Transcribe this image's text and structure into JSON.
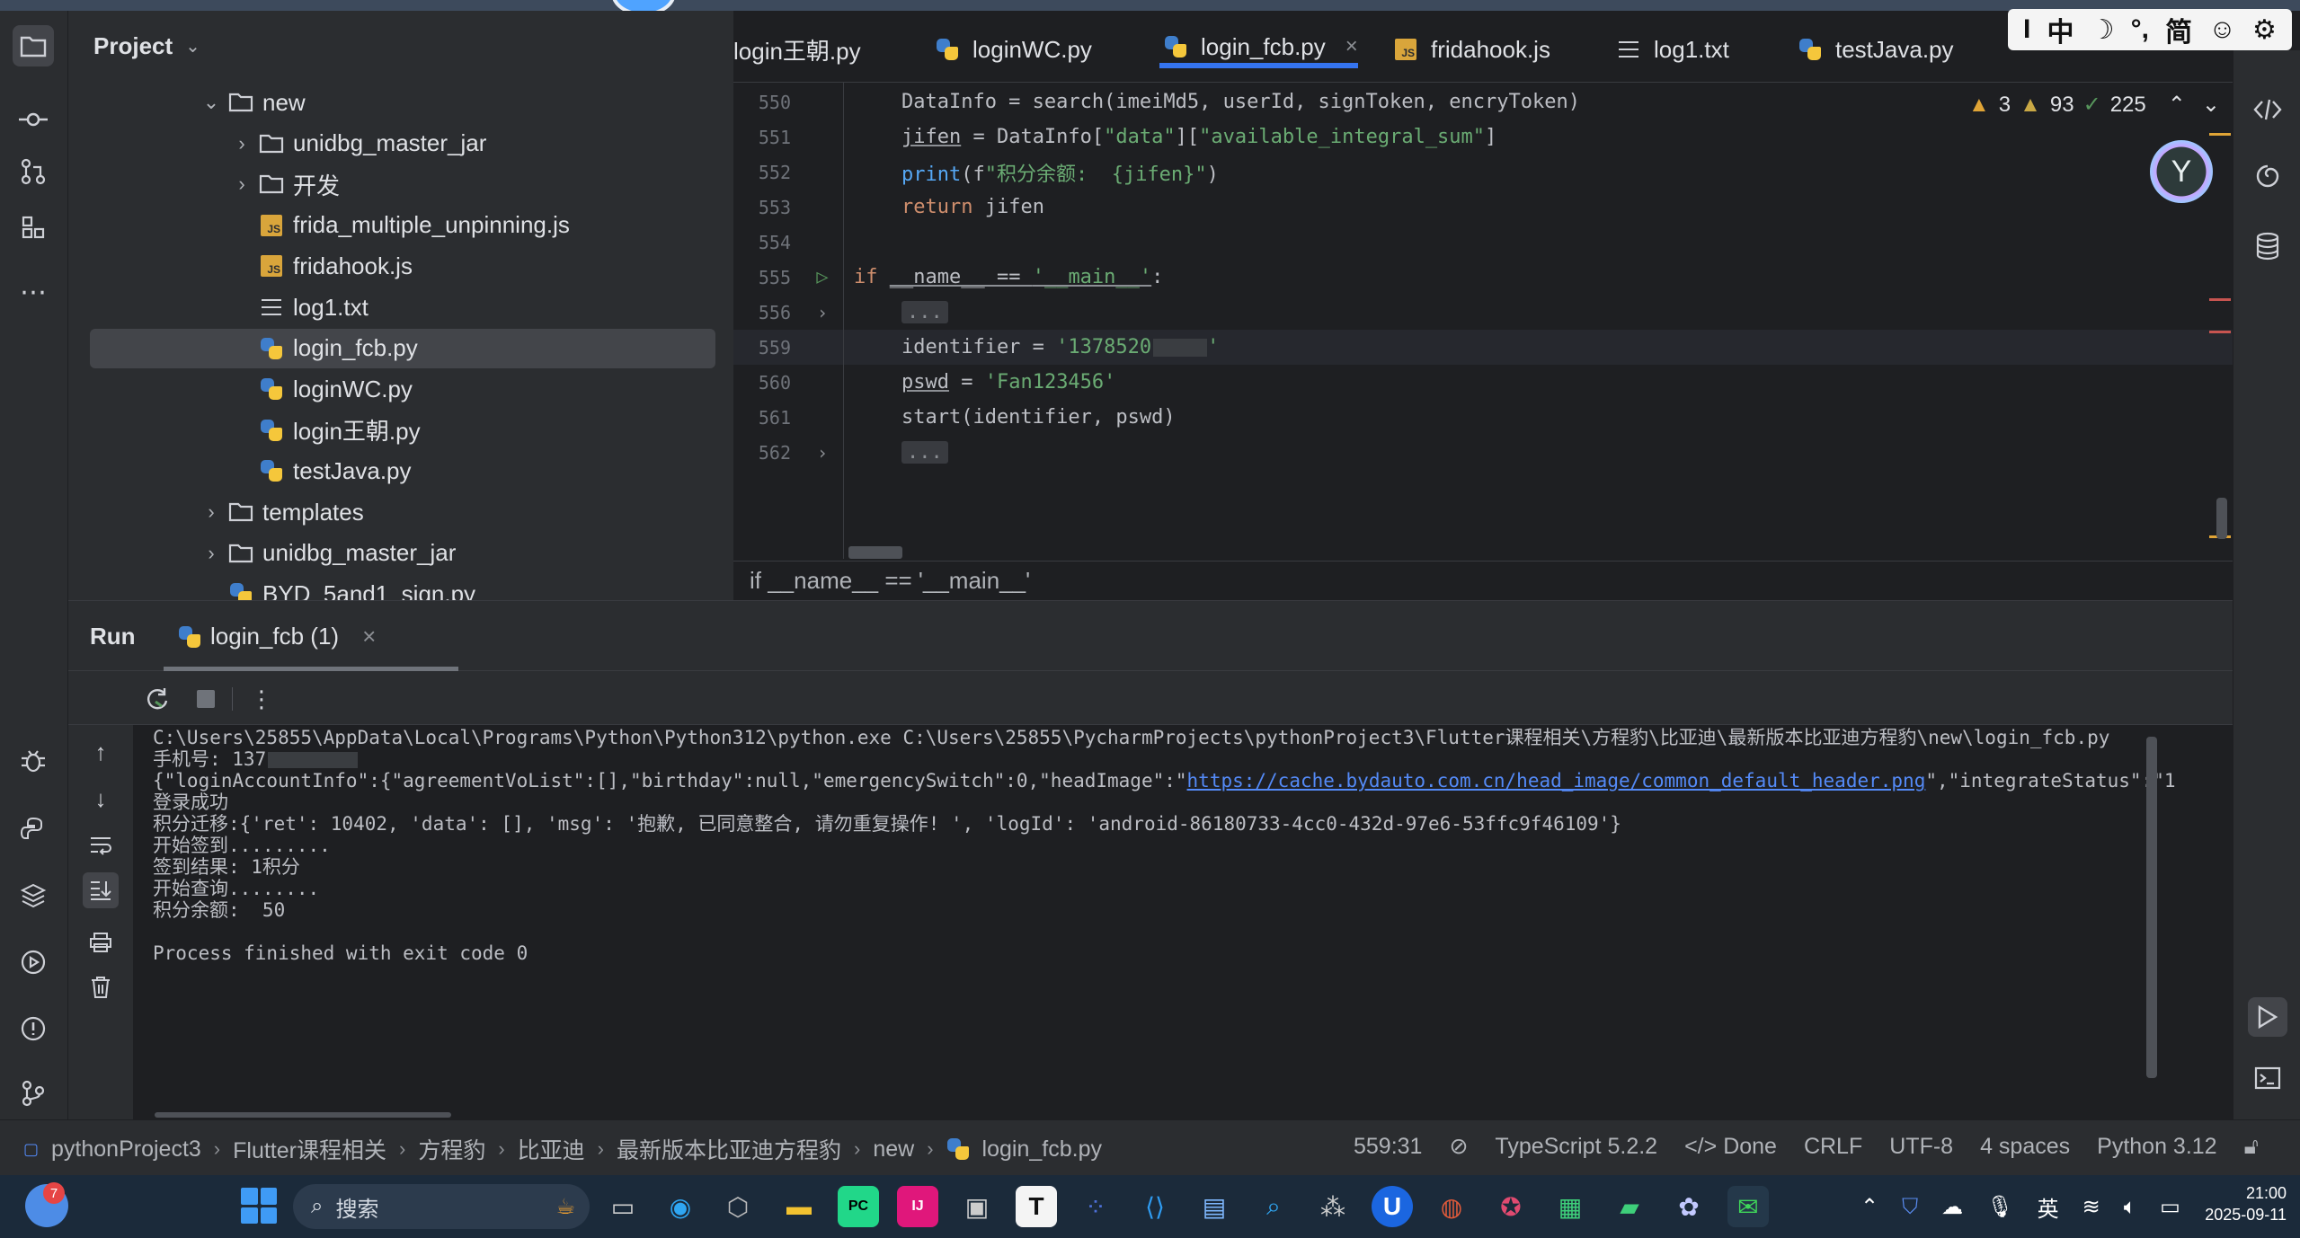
{
  "project": {
    "title": "Project",
    "tree": [
      {
        "label": "new",
        "type": "folder",
        "expanded": true
      },
      {
        "label": "unidbg_master_jar",
        "type": "folder",
        "expanded": false
      },
      {
        "label": "开发",
        "type": "folder",
        "expanded": false
      },
      {
        "label": "frida_multiple_unpinning.js",
        "type": "js"
      },
      {
        "label": "fridahook.js",
        "type": "js"
      },
      {
        "label": "log1.txt",
        "type": "txt"
      },
      {
        "label": "login_fcb.py",
        "type": "py",
        "selected": true
      },
      {
        "label": "loginWC.py",
        "type": "py"
      },
      {
        "label": "login王朝.py",
        "type": "py"
      },
      {
        "label": "testJava.py",
        "type": "py"
      },
      {
        "label": "templates",
        "type": "folder",
        "expanded": false
      },
      {
        "label": "unidbg_master_jar",
        "type": "folder",
        "expanded": false
      },
      {
        "label": "BYD_5and1_sign.py",
        "type": "py"
      }
    ]
  },
  "tabs": [
    {
      "label": "login王朝.py",
      "type": "py"
    },
    {
      "label": "loginWC.py",
      "type": "py"
    },
    {
      "label": "login_fcb.py",
      "type": "py",
      "active": true
    },
    {
      "label": "fridahook.js",
      "type": "js"
    },
    {
      "label": "log1.txt",
      "type": "txt"
    },
    {
      "label": "testJava.py",
      "type": "py"
    }
  ],
  "ime": {
    "items": [
      "I",
      "中",
      "☽",
      "°,",
      "简",
      "☺",
      "⚙"
    ]
  },
  "inspections": {
    "errors": "3",
    "warnings": "93",
    "weak": "225"
  },
  "editor": {
    "lines": [
      {
        "num": "550",
        "text": "    DataInfo = search(imeiMd5, userId, signToken, encryToken)"
      },
      {
        "num": "551",
        "text": "    jifen = DataInfo[\"data\"][\"available_integral_sum\"]"
      },
      {
        "num": "552",
        "text": "    print(f\"积分余额:  {jifen}\")"
      },
      {
        "num": "553",
        "text": "    return jifen"
      },
      {
        "num": "554",
        "text": ""
      },
      {
        "num": "555",
        "text": "if __name__ == '__main__':"
      },
      {
        "num": "556",
        "text": "    ..."
      },
      {
        "num": "559",
        "text": "    identifier = '1378520"
      },
      {
        "num": "560",
        "text": "    pswd = 'Fan123456'"
      },
      {
        "num": "561",
        "text": "    start(identifier, pswd)"
      },
      {
        "num": "562",
        "text": "    ..."
      }
    ],
    "breadcrumb": "if __name__ == '__main__'"
  },
  "run": {
    "title": "Run",
    "tab_label": "login_fcb (1)",
    "console": [
      "C:\\Users\\25855\\AppData\\Local\\Programs\\Python\\Python312\\python.exe C:\\Users\\25855\\PycharmProjects\\pythonProject3\\Flutter课程相关\\方程豹\\比亚迪\\最新版本比亚迪方程豹\\new\\login_fcb.py",
      "手机号: 137",
      "{\"loginAccountInfo\":{\"agreementVoList\":[],\"birthday\":null,\"emergencySwitch\":0,\"headImage\":\"",
      "https://cache.bydauto.com.cn/head_image/common_default_header.png",
      "\",\"integrateStatus\":\"1",
      "登录成功",
      "积分迁移:{'ret': 10402, 'data': [], 'msg': '抱歉, 已同意整合, 请勿重复操作! ', 'logId': 'android-86180733-4cc0-432d-97e6-53ffc9f46109'}",
      "开始签到.........",
      "签到结果: 1积分",
      "开始查询........",
      "积分余额:  50",
      "",
      "Process finished with exit code 0"
    ]
  },
  "status": {
    "crumbs": [
      "pythonProject3",
      "Flutter课程相关",
      "方程豹",
      "比亚迪",
      "最新版本比亚迪方程豹",
      "new",
      "login_fcb.py"
    ],
    "position": "559:31",
    "language_service": "TypeScript 5.2.2",
    "done": "Done",
    "line_sep": "CRLF",
    "encoding": "UTF-8",
    "indent": "4 spaces",
    "interpreter": "Python 3.12"
  },
  "taskbar": {
    "weather_badge": "7",
    "search_placeholder": "搜索",
    "ime_label": "英",
    "time": "21:00",
    "date": "2025-09-11"
  },
  "colors": {
    "accent": "#3574f0",
    "keyword": "#cf8e6d",
    "string": "#6aab73",
    "link": "#548af7",
    "warning": "#e0a436"
  }
}
